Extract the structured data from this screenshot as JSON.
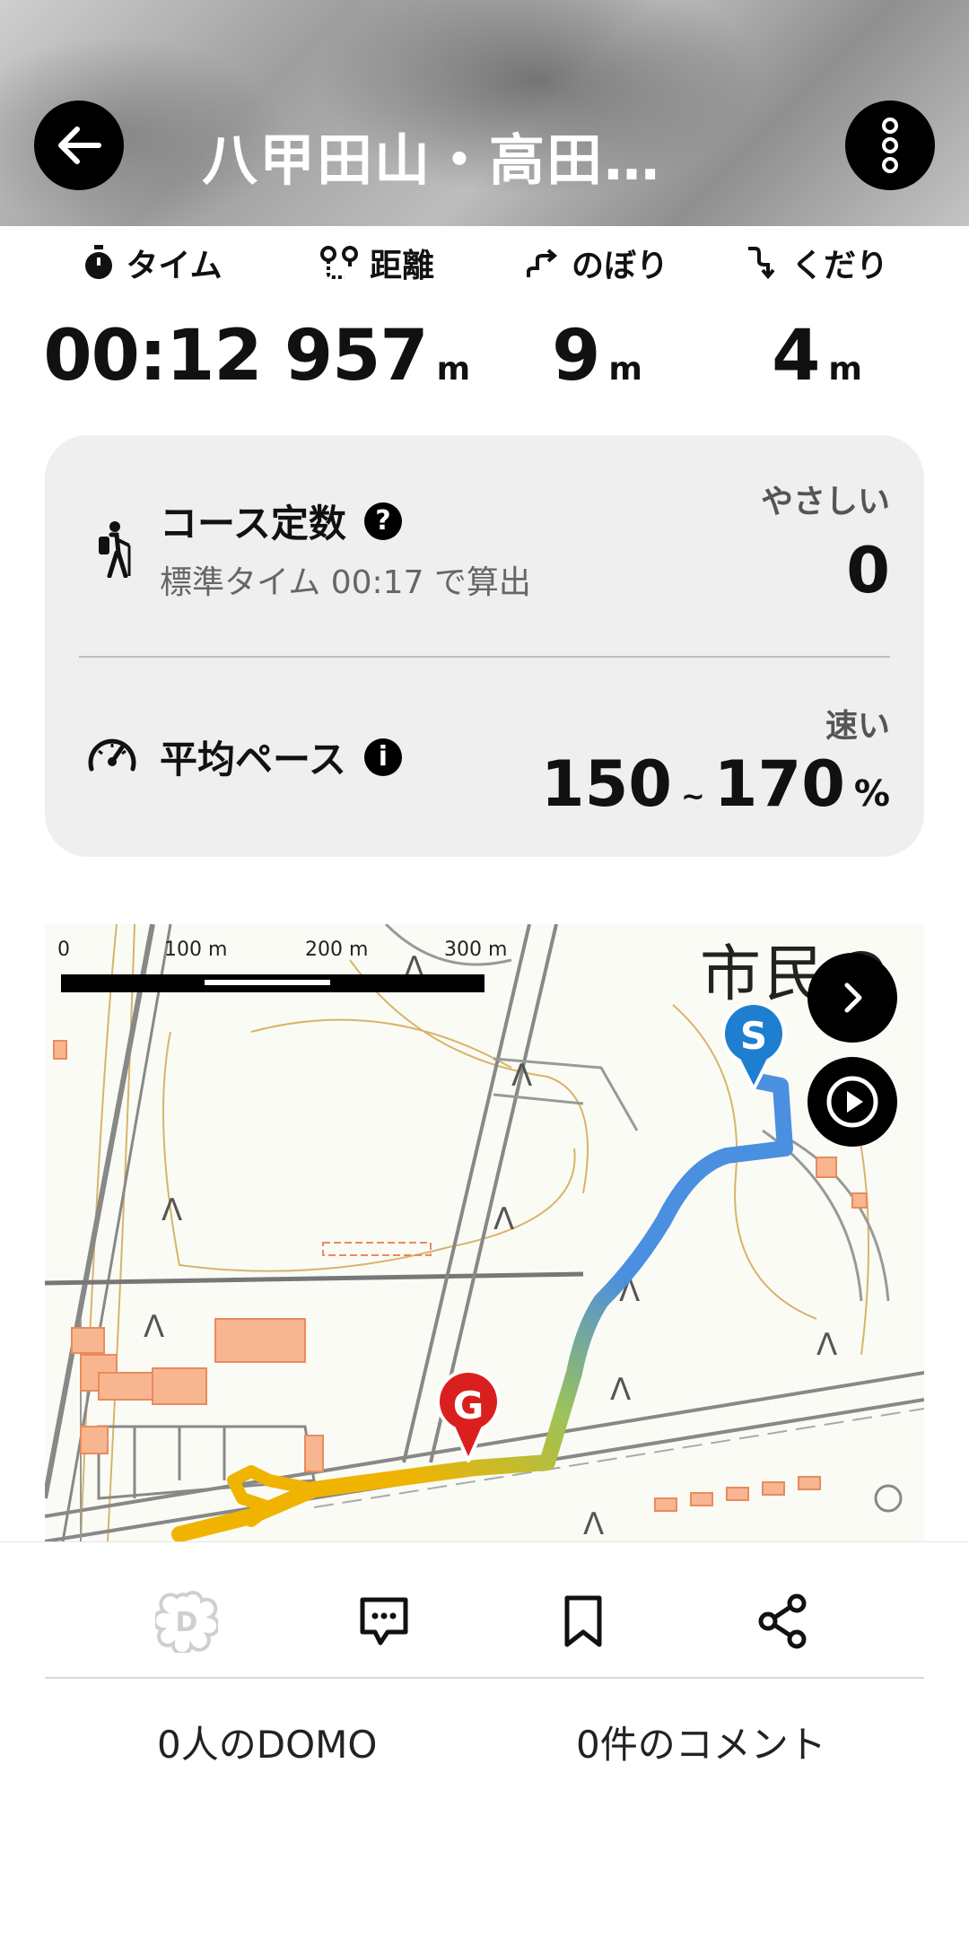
{
  "header": {
    "title": "八甲田山・高田…",
    "back_icon": "arrow-left-icon",
    "menu_icon": "more-vertical-icon"
  },
  "stats": [
    {
      "label": "タイム",
      "value": "00:12",
      "unit": "",
      "icon": "stopwatch-icon"
    },
    {
      "label": "距離",
      "value": "957",
      "unit": "m",
      "icon": "route-icon"
    },
    {
      "label": "のぼり",
      "value": "9",
      "unit": "m",
      "icon": "ascent-icon"
    },
    {
      "label": "くだり",
      "value": "4",
      "unit": "m",
      "icon": "descent-icon"
    }
  ],
  "course": {
    "title": "コース定数",
    "help": "?",
    "subtitle": "標準タイム 00:17 で算出",
    "difficulty_label": "やさしい",
    "value": "0"
  },
  "pace": {
    "title": "平均ペース",
    "info": "i",
    "speed_label": "速い",
    "range_low": "150",
    "range_sep": "~",
    "range_high": "170",
    "unit": "%"
  },
  "map": {
    "scale_labels": [
      "0",
      "100 m",
      "200 m",
      "300 m"
    ],
    "place_text": "市民の",
    "start_marker": "S",
    "goal_marker": "G",
    "colors": {
      "start": "#1e7fd0",
      "goal": "#d9201f",
      "route_start": "#4a8fe0",
      "route_end": "#f0b400"
    }
  },
  "bottom": {
    "domo_count": "0人のDOMO",
    "comment_count": "0件のコメント"
  }
}
